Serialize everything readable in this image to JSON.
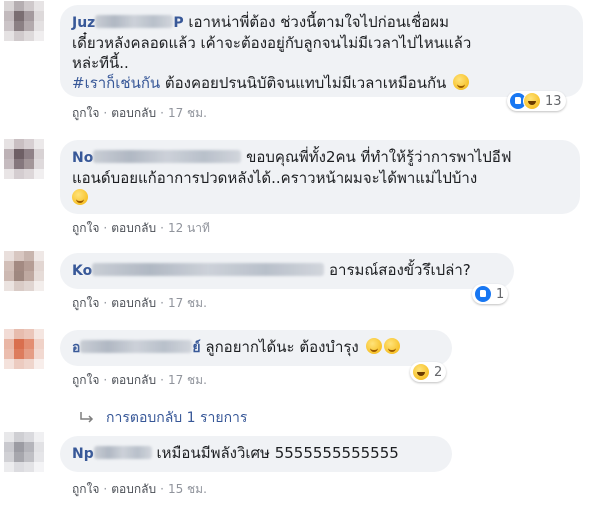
{
  "actions": {
    "like": "ถูกใจ",
    "reply": "ตอบกลับ"
  },
  "comments": [
    {
      "author_visible": "Juz",
      "author_tail": "P",
      "lines": [
        "เอาหน่าพี่ต้อง ช่วงนี้ตามใจไปก่อนเชื่อผม",
        "เดี๋ยวหลังคลอดแล้ว เค้าจะต้องอยู่กับลูกจนไม่มีเวลาไปไหนแล้ว",
        "หล่ะทีนี้.."
      ],
      "hashtag": "#เราก็เช่นกัน",
      "last_text": " ต้องคอยปรนนิบัติจนแทบไม่มีเวลาเหมือนกัน",
      "reactions_count": "13",
      "time": "17 ชม."
    },
    {
      "author_visible": "No",
      "lines": [
        "ขอบคุณพี่ทั้ง2คน ที่ทำให้รู้ว่าการพาไปอีฟ",
        "แอนด์บอยแก้อาการปวดหลังได้..คราวหน้าผมจะได้พาแม่ไปบ้าง"
      ],
      "time": "12 นาที"
    },
    {
      "author_visible": "Ko",
      "text": "อารมณ์สองขั้วรึเปล่า?",
      "reactions_count": "1",
      "time": "17 ชม."
    },
    {
      "author_visible": "อ",
      "author_tail": "ย์",
      "text": "ลูกอยากได้นะ ต้องบำรุง",
      "reactions_count": "2",
      "time": "17 ชม."
    },
    {
      "author_visible": "Np",
      "text": "เหมือนมีพลังวิเศษ 5555555555555",
      "time": "15 ชม."
    }
  ],
  "replies_link": "การตอบกลับ 1 รายการ",
  "icons": [
    "like-reaction-icon",
    "haha-reaction-icon",
    "grinning-emoji-icon",
    "reply-arrow-icon"
  ],
  "colors": {
    "link": "#385898",
    "bubble": "#f0f2f5",
    "like": "#1877f2",
    "muted": "#90949c"
  }
}
